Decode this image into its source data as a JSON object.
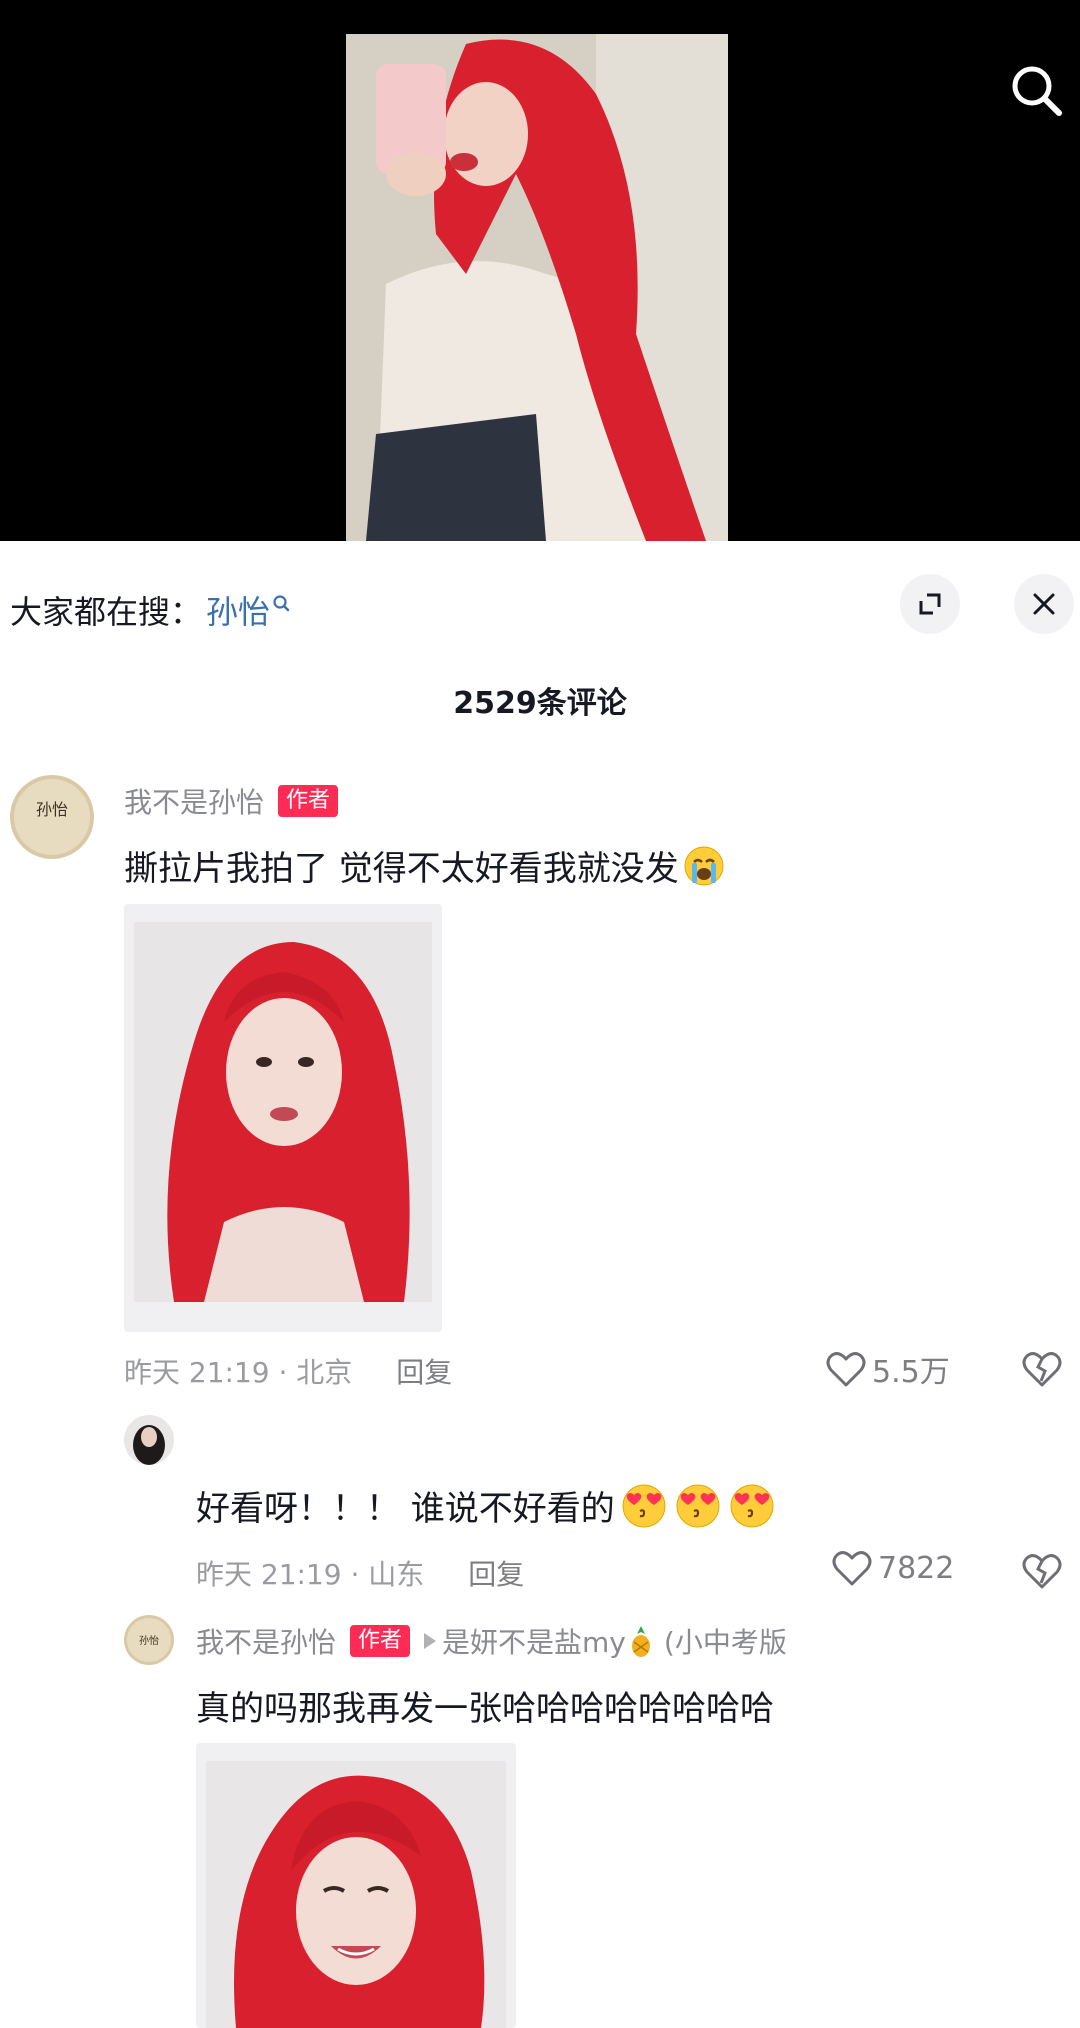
{
  "hot_search": {
    "label": "大家都在搜：",
    "keyword": "孙怡"
  },
  "comments_count": "2529条评论",
  "comments": [
    {
      "username": "我不是孙怡",
      "badge": "作者",
      "text": "撕拉片我拍了 觉得不太好看我就没发",
      "time_location": "昨天 21:19 · 北京",
      "reply_label": "回复",
      "likes": "5.5万"
    },
    {
      "username": "",
      "text": "好看呀！！！ 谁说不好看的",
      "time_location": "昨天 21:19 · 山东",
      "reply_label": "回复",
      "likes": "7822"
    },
    {
      "username": "我不是孙怡",
      "badge": "作者",
      "reply_to": "是妍不是盐my",
      "reply_to_suffix": "(小中考版",
      "text": "真的吗那我再发一张哈哈哈哈哈哈哈哈"
    }
  ],
  "colors": {
    "accent_red": "#fe2c55",
    "keyword_blue": "#3a6fb0",
    "hair_red": "#d8202e"
  },
  "icons": [
    "search-icon",
    "expand-icon",
    "close-icon",
    "heart-icon",
    "broken-heart-icon",
    "crying-emoji",
    "heart-eyes-emoji",
    "pineapple-emoji"
  ]
}
